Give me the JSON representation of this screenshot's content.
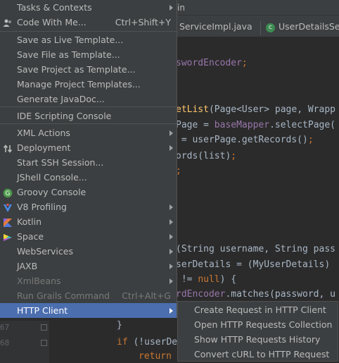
{
  "editor": {
    "menu_tail": "in",
    "tabs": [
      {
        "label": "ServiceImpl.java"
      },
      {
        "icon": "class-icon",
        "icon_letter": "c",
        "label": "UserDetailsSer"
      }
    ],
    "code_lines": [
      {
        "parts": [
          {
            "t": "swordEncoder",
            "c": "purple"
          },
          {
            "t": ";",
            "c": "orange"
          }
        ]
      },
      {
        "parts": [
          {
            "t": "etList",
            "c": "yellow"
          },
          {
            "t": "(Page<User> page, Wrapp",
            "c": "white"
          }
        ]
      },
      {
        "parts": [
          {
            "t": "Page = ",
            "c": "white"
          },
          {
            "t": "baseMapper",
            "c": "purple"
          },
          {
            "t": ".selectPage(",
            "c": "white"
          }
        ]
      },
      {
        "parts": [
          {
            "t": " = userPage.getRecords()",
            "c": "white"
          },
          {
            "t": ";",
            "c": "orange"
          }
        ]
      },
      {
        "parts": [
          {
            "t": "ords(list)",
            "c": "white"
          },
          {
            "t": ";",
            "c": "orange"
          }
        ]
      },
      {
        "parts": [
          {
            "t": ";",
            "c": "orange"
          }
        ]
      },
      {
        "parts": [
          {
            "t": "(String username, String pass",
            "c": "white"
          }
        ]
      },
      {
        "parts": [
          {
            "t": "serDetails = (MyUserDetails)",
            "c": "white"
          }
        ]
      },
      {
        "parts": [
          {
            "t": " != ",
            "c": "white"
          },
          {
            "t": "null",
            "c": "orange"
          },
          {
            "t": ") {",
            "c": "white"
          }
        ]
      },
      {
        "parts": [
          {
            "t": "rdEncoder",
            "c": "purple"
          },
          {
            "t": ".matches(password, u",
            "c": "white"
          }
        ]
      },
      {
        "parts": [
          {
            "t": "}",
            "c": "white"
          }
        ]
      },
      {
        "parts": [
          {
            "t": "if ",
            "c": "orange"
          },
          {
            "t": "(!userDe",
            "c": "white"
          }
        ]
      },
      {
        "parts": [
          {
            "t": "return ",
            "c": "orange"
          }
        ]
      }
    ],
    "line_numbers": [
      "67",
      "68"
    ]
  },
  "menu": {
    "items": [
      {
        "label": "Tasks & Contexts",
        "submenu": true
      },
      {
        "label": "Code With Me...",
        "shortcut": "Ctrl+Shift+Y",
        "icon": "code-with-me-icon"
      },
      {
        "separator": true
      },
      {
        "label": "Save as Live Template..."
      },
      {
        "label": "Save File as Template..."
      },
      {
        "label": "Save Project as Template..."
      },
      {
        "label": "Manage Project Templates..."
      },
      {
        "label": "Generate JavaDoc..."
      },
      {
        "separator": true
      },
      {
        "label": "IDE Scripting Console"
      },
      {
        "separator": true
      },
      {
        "label": "XML Actions",
        "submenu": true
      },
      {
        "label": "Deployment",
        "submenu": true,
        "icon": "deployment-icon"
      },
      {
        "label": "Start SSH Session..."
      },
      {
        "label": "JShell Console..."
      },
      {
        "label": "Groovy Console",
        "icon": "groovy-icon"
      },
      {
        "label": "V8 Profiling",
        "submenu": true,
        "icon": "v8-icon"
      },
      {
        "label": "Kotlin",
        "submenu": true,
        "icon": "kotlin-icon"
      },
      {
        "label": "Space",
        "submenu": true,
        "icon": "space-icon"
      },
      {
        "label": "WebServices",
        "submenu": true
      },
      {
        "label": "JAXB",
        "submenu": true
      },
      {
        "label": "XmlBeans",
        "submenu": true,
        "disabled": true
      },
      {
        "label": "Run Grails Command",
        "shortcut": "Ctrl+Alt+G",
        "disabled": true
      },
      {
        "label": "HTTP Client",
        "submenu": true,
        "selected": true
      }
    ]
  },
  "submenu": {
    "items": [
      {
        "label": "Create Request in HTTP Client"
      },
      {
        "label": "Open HTTP Requests Collection"
      },
      {
        "label": "Show HTTP Requests History"
      },
      {
        "label": "Convert cURL to HTTP Request"
      }
    ]
  },
  "colors": {
    "menu_bg": "#3c3f41",
    "selection": "#4b6eaf",
    "editor_bg": "#2b2b2b"
  }
}
